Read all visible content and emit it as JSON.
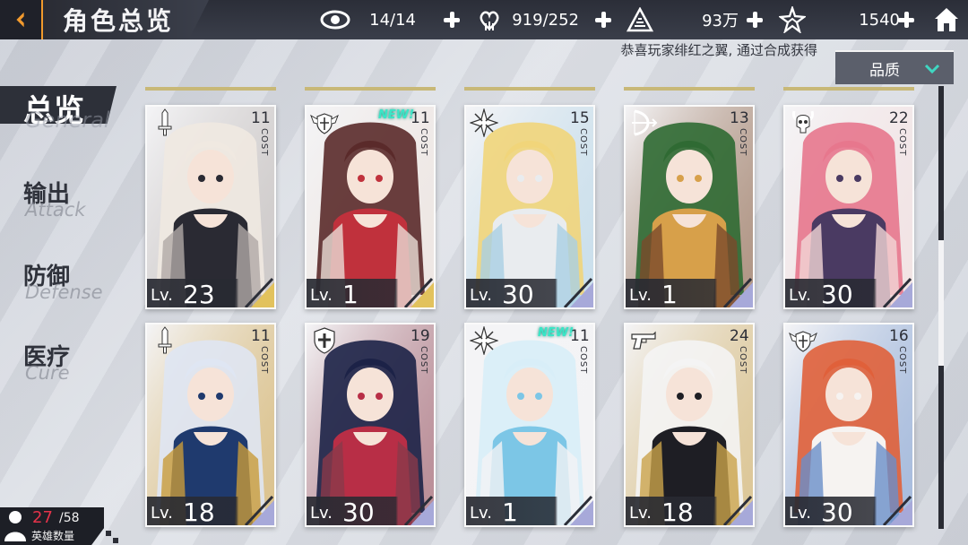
{
  "header": {
    "title": "角色总览",
    "resources": [
      {
        "name": "vision",
        "icon": "eye-icon",
        "value": "14/14"
      },
      {
        "name": "hearts",
        "icon": "heart-hand-icon",
        "value": "919/252"
      },
      {
        "name": "gold",
        "icon": "crystal-triangle-icon",
        "value": "93万"
      },
      {
        "name": "stars",
        "icon": "star-shard-icon",
        "value": "1540"
      }
    ]
  },
  "notice": "恭喜玩家绯红之翼, 通过合成获得",
  "filter": {
    "label": "品质"
  },
  "nav": [
    {
      "zh": "总览",
      "en": "General",
      "active": true
    },
    {
      "zh": "输出",
      "en": "Attack",
      "active": false
    },
    {
      "zh": "防御",
      "en": "Defense",
      "active": false
    },
    {
      "zh": "医疗",
      "en": "Cure",
      "active": false
    }
  ],
  "card_labels": {
    "cost": "COST",
    "new": "NEW!",
    "lv": "Lv."
  },
  "cards": [
    {
      "cost": "11",
      "level": "23",
      "class_icon": "sword-icon",
      "is_new": false,
      "palette": [
        "#f0e9e1",
        "#2a2a33",
        "#b0a9a6"
      ],
      "rarity_color": "#e2c25d"
    },
    {
      "cost": "11",
      "level": "1",
      "class_icon": "winged-shield-icon",
      "is_new": true,
      "palette": [
        "#5a2a2a",
        "#c0313c",
        "#e9dcd4"
      ],
      "rarity_color": "#e2c25d"
    },
    {
      "cost": "15",
      "level": "30",
      "class_icon": "star-burst-icon",
      "is_new": false,
      "palette": [
        "#f1d57a",
        "#e9ecef",
        "#a9cfe4"
      ],
      "rarity_color": "#a7a9d9"
    },
    {
      "cost": "13",
      "level": "1",
      "class_icon": "bow-icon",
      "is_new": false,
      "palette": [
        "#2f6a33",
        "#d7a04a",
        "#7a4a2a"
      ],
      "rarity_color": "#a7a9d9"
    },
    {
      "cost": "22",
      "level": "30",
      "class_icon": "horned-skull-icon",
      "is_new": false,
      "palette": [
        "#e7778d",
        "#4a3a62",
        "#f1d6d6"
      ],
      "rarity_color": "#a7a9d9"
    },
    {
      "cost": "11",
      "level": "18",
      "class_icon": "sword-icon",
      "is_new": false,
      "palette": [
        "#dfe6f3",
        "#1f3a6e",
        "#c89b3a"
      ],
      "rarity_color": "#a7a9d9"
    },
    {
      "cost": "19",
      "level": "30",
      "class_icon": "cross-shield-icon",
      "is_new": false,
      "palette": [
        "#1c2247",
        "#b82e46",
        "#8a3a4a"
      ],
      "rarity_color": "#a7a9d9"
    },
    {
      "cost": "11",
      "level": "1",
      "class_icon": "star-burst-icon",
      "is_new": true,
      "palette": [
        "#d8eef8",
        "#7cc6e6",
        "#f3f3f5"
      ],
      "rarity_color": "#a7a9d9"
    },
    {
      "cost": "24",
      "level": "18",
      "class_icon": "pistol-icon",
      "is_new": false,
      "palette": [
        "#f4f4f4",
        "#1e1e24",
        "#c9a24a"
      ],
      "rarity_color": "#a7a9d9"
    },
    {
      "cost": "16",
      "level": "30",
      "class_icon": "winged-shield-icon",
      "is_new": false,
      "palette": [
        "#e0603a",
        "#f6f3f1",
        "#6a8fc9"
      ],
      "rarity_color": "#a7a9d9"
    }
  ],
  "hero_count": {
    "current": "27",
    "total": "/58",
    "caption": "英雄数量"
  }
}
